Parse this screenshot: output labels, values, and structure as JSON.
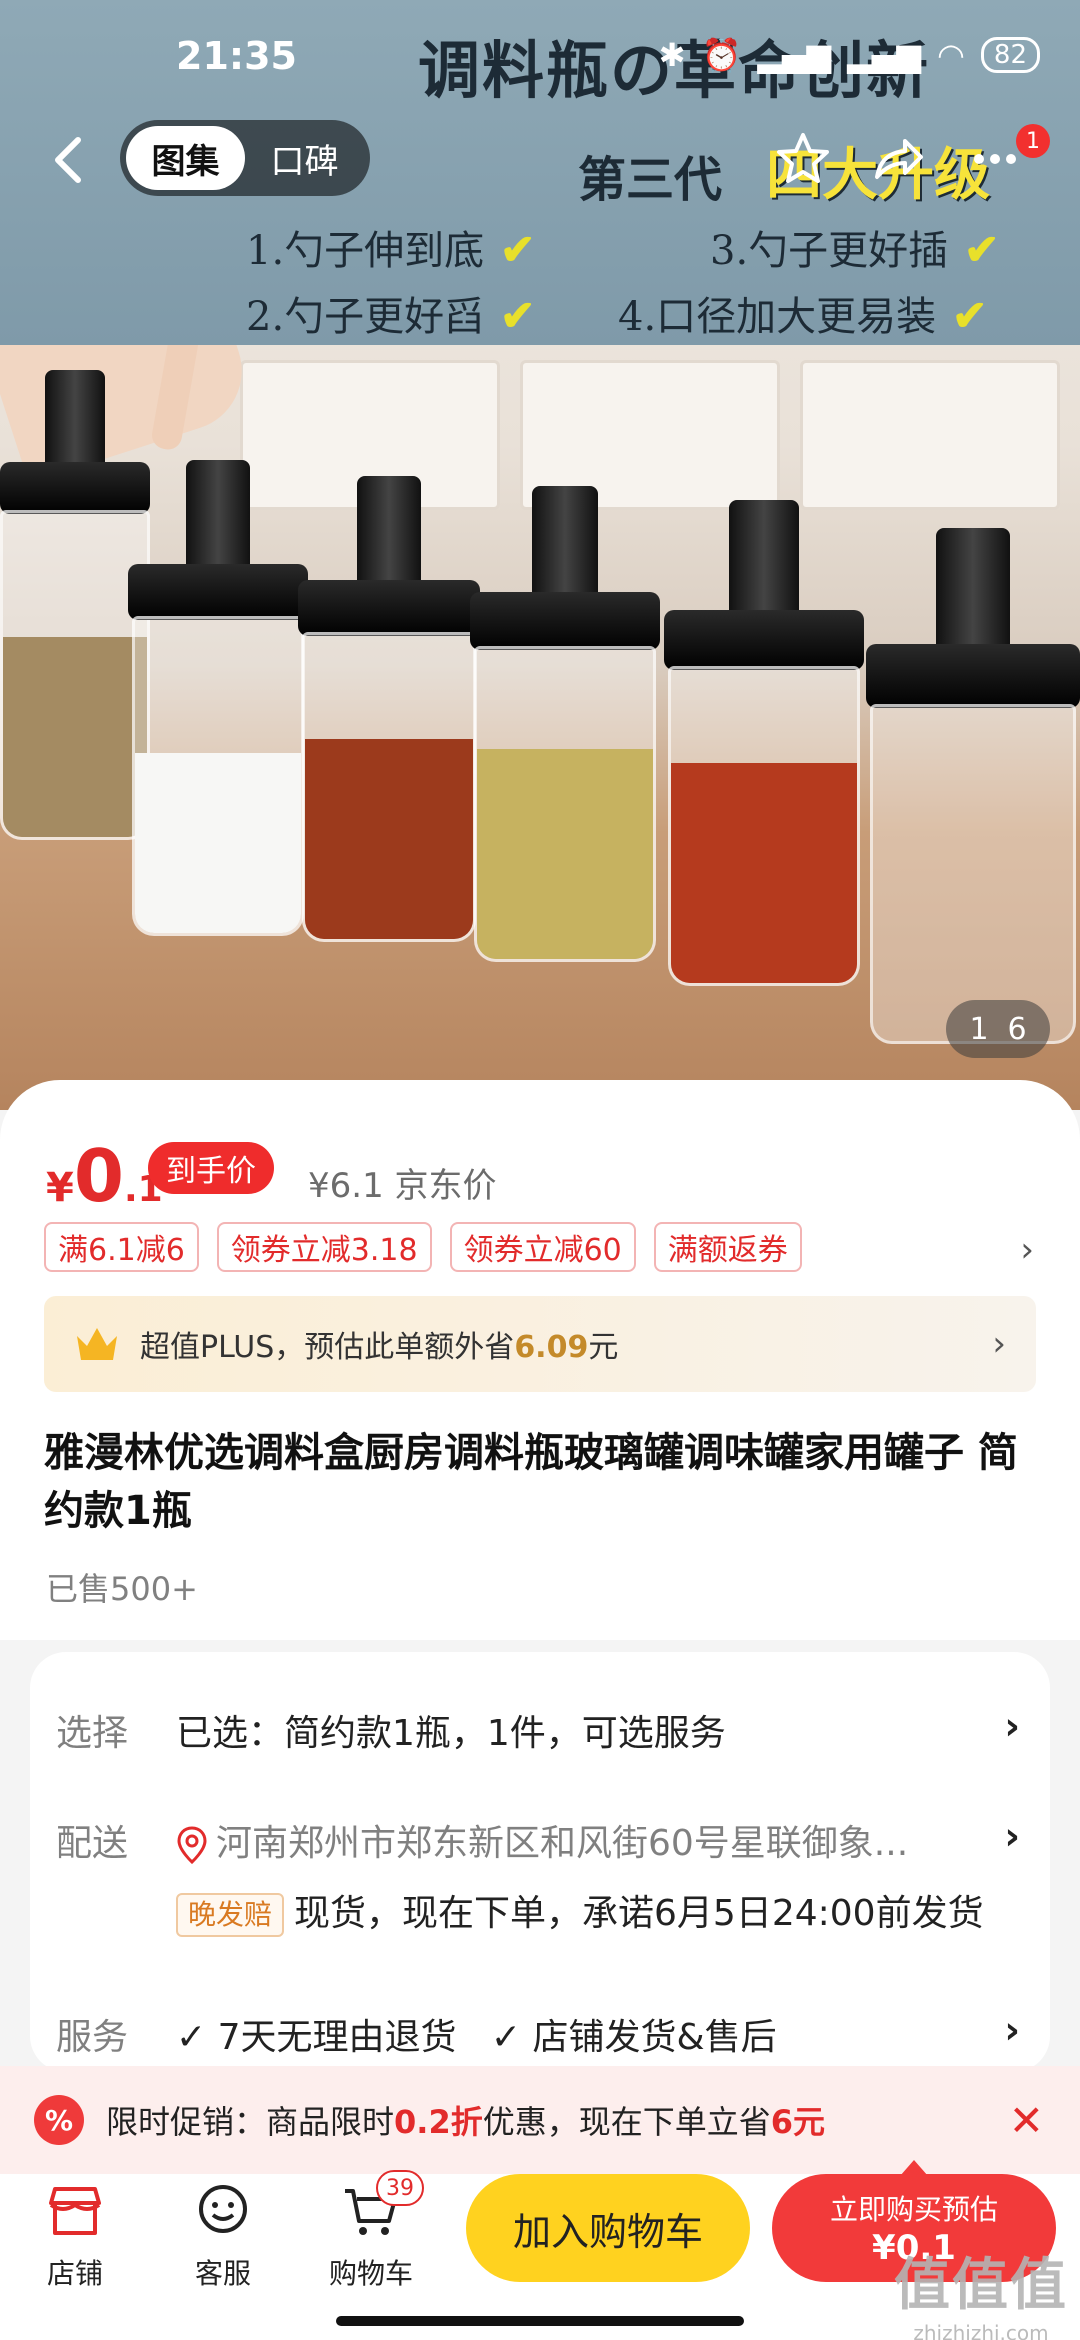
{
  "status": {
    "time": "21:35",
    "battery": "82"
  },
  "nav": {
    "tabs": [
      {
        "label": "图集",
        "active": true
      },
      {
        "label": "口碑",
        "active": false
      }
    ],
    "more_badge": "1"
  },
  "hero": {
    "banner_title": "调料瓶の革命创新",
    "banner_prefix": "第三代",
    "banner_highlight": "四大升级",
    "features": [
      "1.勺子伸到底",
      "3.勺子更好插",
      "2.勺子更好舀",
      "4.口径加大更易装"
    ],
    "counter_current": "1",
    "counter_total": "6"
  },
  "price": {
    "currency": "¥",
    "main": "0",
    "decimal": ".1",
    "tag": "到手价",
    "jd_price": "¥6.1 京东价"
  },
  "coupons": [
    "满6.1减6",
    "领券立减3.18",
    "领券立减60",
    "满额返券"
  ],
  "plus": {
    "prefix": "超值PLUS，预估此单额外省",
    "amount": "6.09",
    "suffix": "元"
  },
  "product": {
    "title": "雅漫林优选调料盒厨房调料瓶玻璃罐调味罐家用罐子 简约款1瓶",
    "sold": "已售500+"
  },
  "options": {
    "select_label": "选择",
    "select_value": "已选：简约款1瓶，1件，可选服务",
    "delivery_label": "配送",
    "address": "河南郑州市郑东新区和风街60号星联御象...",
    "late_tag": "晚发赔",
    "ship_text": "现货，现在下单，承诺6月5日24:00前发货",
    "service_label": "服务",
    "services": [
      "7天无理由退货",
      "店铺发货&售后"
    ]
  },
  "promo": {
    "icon": "%",
    "pre": "限时促销：商品限时",
    "discount": "0.2折",
    "mid": "优惠，现在下单立省",
    "save": "6元"
  },
  "bottom": {
    "store": "店铺",
    "service": "客服",
    "cart": "购物车",
    "cart_count": "39",
    "add_cart": "加入购物车",
    "buy_line1": "立即购买预估",
    "buy_line2": "¥0.1"
  },
  "watermark": {
    "line1": "值值值",
    "line2": "zhizhizhi.com"
  },
  "colors": {
    "accent_red": "#e22b2b",
    "cart_yellow": "#ffd21f",
    "buy_red": "#f23a3a"
  }
}
